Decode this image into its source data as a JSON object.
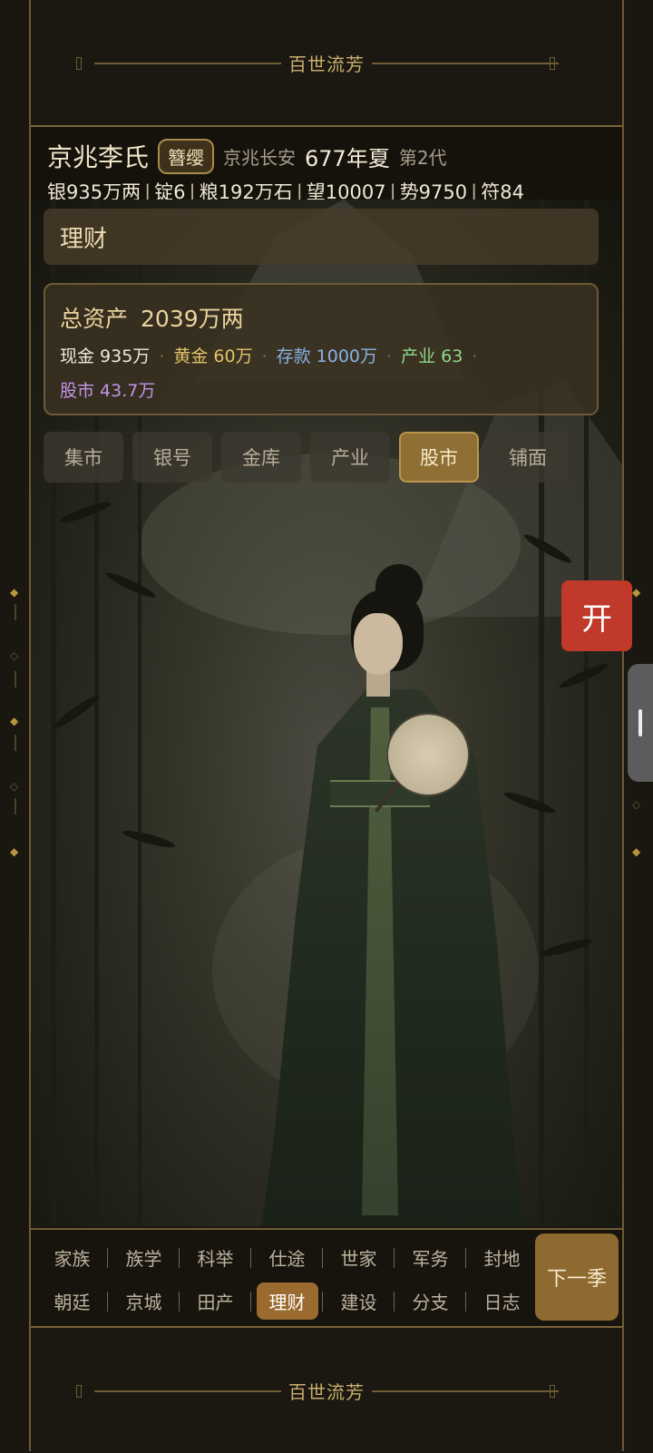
{
  "banner": {
    "top_text": "百世流芳",
    "bottom_text": "百世流芳"
  },
  "header": {
    "clan": "京兆李氏",
    "rank": "簪缨",
    "place": "京兆长安",
    "date": "677年夏",
    "generation": "第2代",
    "stats": [
      "银935万两",
      "锭6",
      "粮192万石",
      "望10007",
      "势9750",
      "符84"
    ]
  },
  "panel": {
    "title": "理财"
  },
  "assets": {
    "total_label": "总资产",
    "total_value": "2039万两",
    "cash": "现金 935万",
    "gold": "黄金 60万",
    "deposit": "存款 1000万",
    "industry": "产业 63",
    "stock": "股市 43.7万",
    "colors": {
      "cash": "#f0e8d8",
      "gold": "#e3c26a",
      "deposit": "#8ab2e3",
      "industry": "#8fd88a",
      "stock": "#c494e8"
    }
  },
  "tabs": [
    "集市",
    "银号",
    "金库",
    "产业",
    "股市",
    "铺面"
  ],
  "active_tab": "股市",
  "open_button": "开",
  "nav": {
    "row1": [
      "家族",
      "族学",
      "科举",
      "仕途",
      "世家",
      "军务",
      "封地"
    ],
    "row2": [
      "朝廷",
      "京城",
      "田产",
      "理财",
      "建设",
      "分支",
      "日志"
    ],
    "active": "理财",
    "next": "下一季"
  },
  "theme": {
    "accent": "#8f6f33",
    "frame": "#7a6337",
    "open_btn": "#c0392b"
  }
}
